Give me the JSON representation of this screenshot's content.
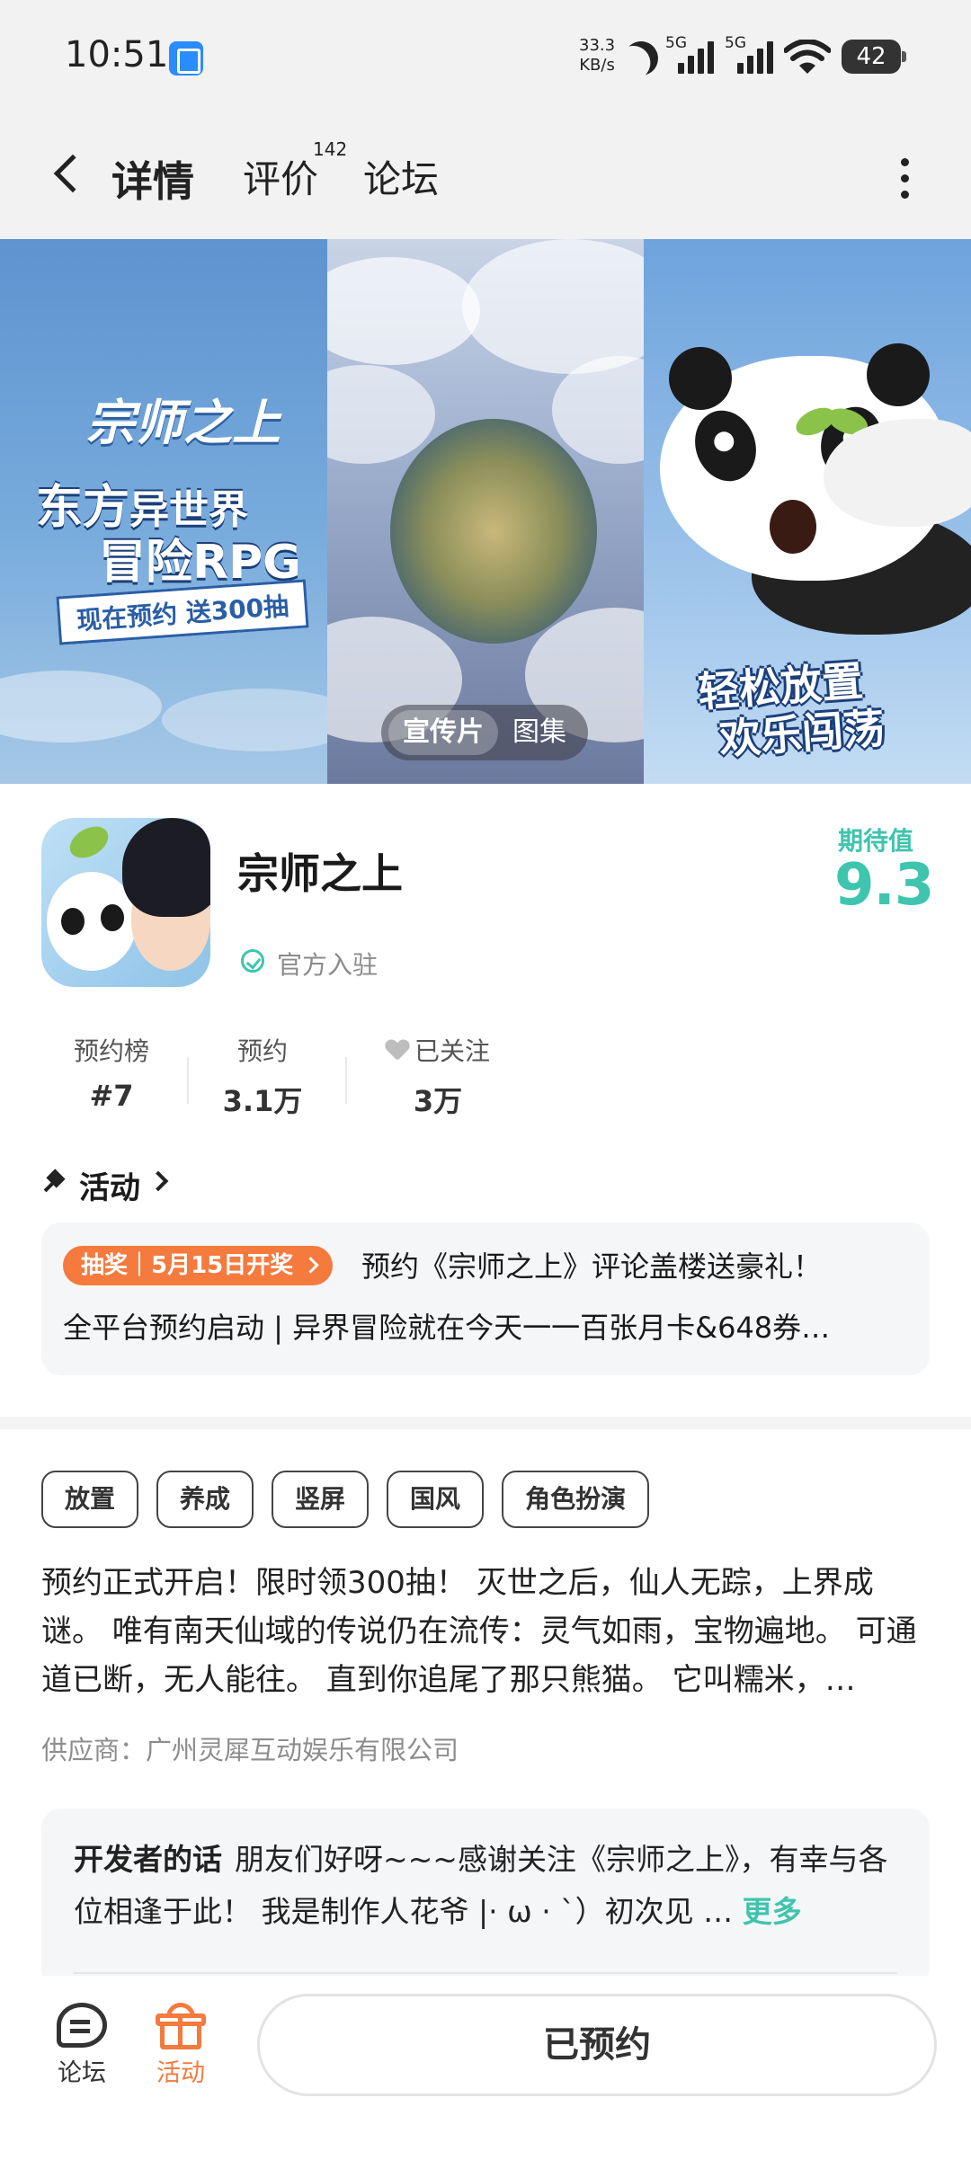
{
  "status_bar": {
    "time": "10:51",
    "net_speed_value": "33.3",
    "net_speed_unit": "KB/s",
    "sim1_label": "5G",
    "sim2_label": "5G",
    "battery": "42"
  },
  "nav": {
    "tabs": [
      {
        "label": "详情",
        "active": true
      },
      {
        "label": "评价",
        "badge": "142"
      },
      {
        "label": "论坛"
      }
    ]
  },
  "banner": {
    "logo": "宗师之上",
    "headline_1_a": "东方",
    "headline_1_b": "异世界",
    "headline_1_c": "冒险RPG",
    "promo": "现在预约 送300抽",
    "headline_3_a": "轻松放置",
    "headline_3_b": "欢乐闯荡",
    "media_options": [
      "宣传片",
      "图集"
    ],
    "accent_color": "#3fd0b8"
  },
  "app": {
    "name": "宗师之上",
    "verified_label": "官方入驻",
    "expect_label": "期待值",
    "expect_score": "9.3"
  },
  "stats": [
    {
      "key": "预约榜",
      "value": "#7"
    },
    {
      "key": "预约",
      "value": "3.1万"
    },
    {
      "key": "已关注",
      "value": "3万"
    }
  ],
  "activity": {
    "title": "活动",
    "badge": "抽奖｜5月15日开奖",
    "line1": "预约《宗师之上》评论盖楼送豪礼！",
    "line2": "全平台预约启动 | 异界冒险就在今天一一百张月卡&648券…"
  },
  "tags": [
    "放置",
    "养成",
    "竖屏",
    "国风",
    "角色扮演"
  ],
  "description": "预约正式开启！限时领300抽！ 灭世之后，仙人无踪，上界成谜。 唯有南天仙域的传说仍在流传：灵气如雨，宝物遍地。 可通道已断，无人能往。 直到你追尾了那只熊猫。 它叫糯米，…",
  "supplier": "供应商：广州灵犀互动娱乐有限公司",
  "developer": {
    "title": "开发者的话",
    "text": "朋友们好呀~~~感谢关注《宗师之上》，有幸与各位相逢于此！ 我是制作人花爷 |· ω · `）初次见 …",
    "more": "更多"
  },
  "bottom_bar": {
    "forum_label": "论坛",
    "activity_label": "活动",
    "reserve_button": "已预约",
    "active_color": "#f47a3e"
  }
}
